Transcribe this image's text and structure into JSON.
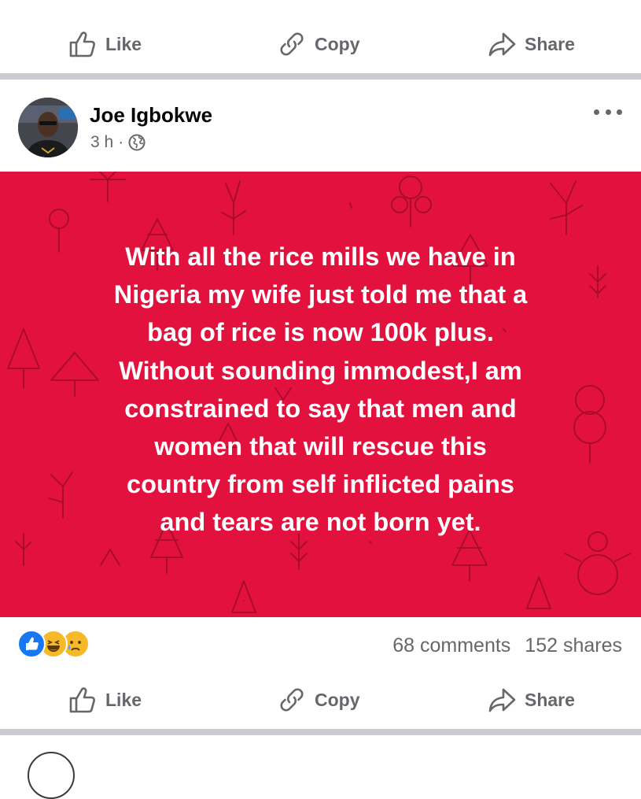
{
  "top_actions": {
    "like": "Like",
    "copy": "Copy",
    "share": "Share"
  },
  "post": {
    "author": "Joe Igbokwe",
    "time": "3 h",
    "meta_separator": "·",
    "privacy_icon": "globe-icon",
    "more_icon": "more-options-icon",
    "background_color": "#e3113d",
    "text": "With all the rice mills we have in\nNigeria my wife just told me that a\nbag of rice is now 100k plus.\nWithout sounding immodest,I am\nconstrained to say that men and\nwomen that will rescue this\ncountry from self inflicted pains\nand tears are not born yet.",
    "reactions": [
      "like-reaction-icon",
      "haha-reaction-icon",
      "sad-reaction-icon"
    ],
    "comments": "68 comments",
    "shares": "152 shares"
  },
  "bottom_actions": {
    "like": "Like",
    "copy": "Copy",
    "share": "Share"
  },
  "colors": {
    "muted": "#65676b",
    "separator": "#c9ccd1",
    "like_blue": "#1877f2"
  }
}
